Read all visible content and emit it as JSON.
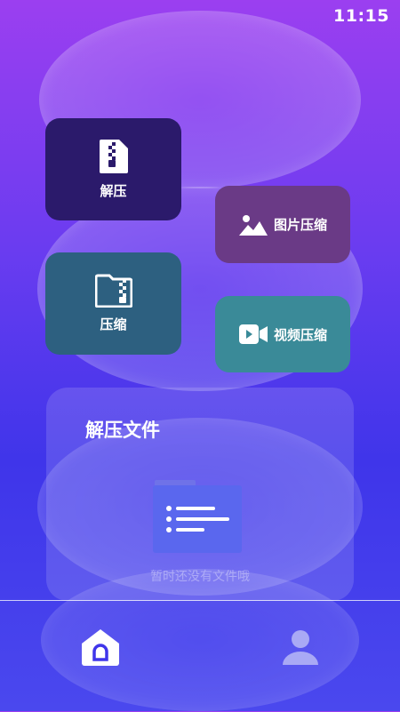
{
  "status": {
    "time": "11:15"
  },
  "tiles": {
    "decompress": {
      "label": "解压",
      "color": "#2b1a6b",
      "icon": "zip-file-icon"
    },
    "image_compress": {
      "label": "图片压缩",
      "color": "#6a3a86",
      "icon": "image-icon"
    },
    "compress": {
      "label": "压缩",
      "color": "#2d6080",
      "icon": "zip-folder-icon"
    },
    "video_compress": {
      "label": "视频压缩",
      "color": "#3a8a98",
      "icon": "video-camera-icon"
    }
  },
  "panel": {
    "title": "解压文件",
    "empty_text": "暂时还没有文件哦"
  },
  "nav": {
    "home_icon": "home-icon",
    "profile_icon": "user-icon"
  }
}
